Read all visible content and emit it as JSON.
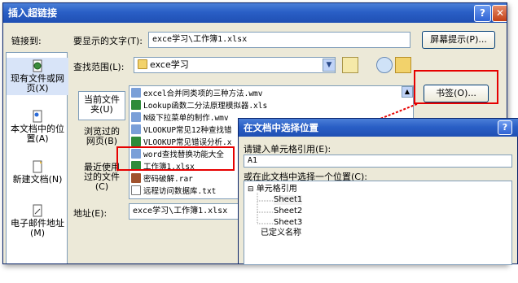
{
  "dialog": {
    "title": "插入超链接",
    "title_visible": "插入超链接",
    "help_glyph": "?",
    "close_glyph": "✕"
  },
  "link_to": {
    "label": "链接到:",
    "items": [
      {
        "label": "现有文件或网页(X)",
        "icon": "globe-document-icon"
      },
      {
        "label": "本文档中的位置(A)",
        "icon": "document-location-icon"
      },
      {
        "label": "新建文档(N)",
        "icon": "new-document-icon"
      },
      {
        "label": "电子邮件地址(M)",
        "icon": "email-icon"
      }
    ]
  },
  "text_to_display": {
    "label": "要显示的文字(T):",
    "value": "exce学习\\工作簿1.xlsx"
  },
  "screen_tip_button": "屏幕提示(P)...",
  "look_in": {
    "label": "查找范围(L):",
    "value": "exce学习"
  },
  "side_buttons": [
    {
      "label": "当前文件夹(U)"
    },
    {
      "label": "浏览过的网页(B)"
    },
    {
      "label": "最近使用过的文件(C)"
    }
  ],
  "files": [
    {
      "name": "excel合并同类项的三种方法.wmv",
      "icon": "video-icon"
    },
    {
      "name": "Lookup函数二分法原理模拟器.xls",
      "icon": "excel-icon"
    },
    {
      "name": "N级下拉菜单的制作.wmv",
      "icon": "video-icon"
    },
    {
      "name": "VLOOKUP常见12种查找错",
      "icon": "video-icon"
    },
    {
      "name": "VLOOKUP常见错误分析.x",
      "icon": "excel-icon"
    },
    {
      "name": "word查找替换功能大全",
      "icon": "video-icon"
    },
    {
      "name": "工作簿1.xlsx",
      "icon": "excel-icon"
    },
    {
      "name": "密码破解.rar",
      "icon": "archive-icon"
    },
    {
      "name": "远程访问数据库.txt",
      "icon": "text-icon"
    }
  ],
  "bookmark_button": "书签(O)...",
  "address": {
    "label": "地址(E):",
    "value": "exce学习\\工作簿1.xlsx"
  },
  "popup": {
    "title": "在文档中选择位置",
    "help_glyph": "?",
    "cell_ref_label": "请键入单元格引用(E):",
    "cell_ref_value": "A1",
    "place_label": "或在此文档中选择一个位置(C):",
    "tree": {
      "root": "单元格引用",
      "collapse_glyph": "⊟",
      "children": [
        "Sheet1",
        "Sheet2",
        "Sheet3"
      ],
      "defined_names": "已定义名称"
    }
  },
  "colors": {
    "annotation_red": "#e60000",
    "title_blue": "#2a5fc6",
    "dialog_bg": "#ece9d8"
  }
}
